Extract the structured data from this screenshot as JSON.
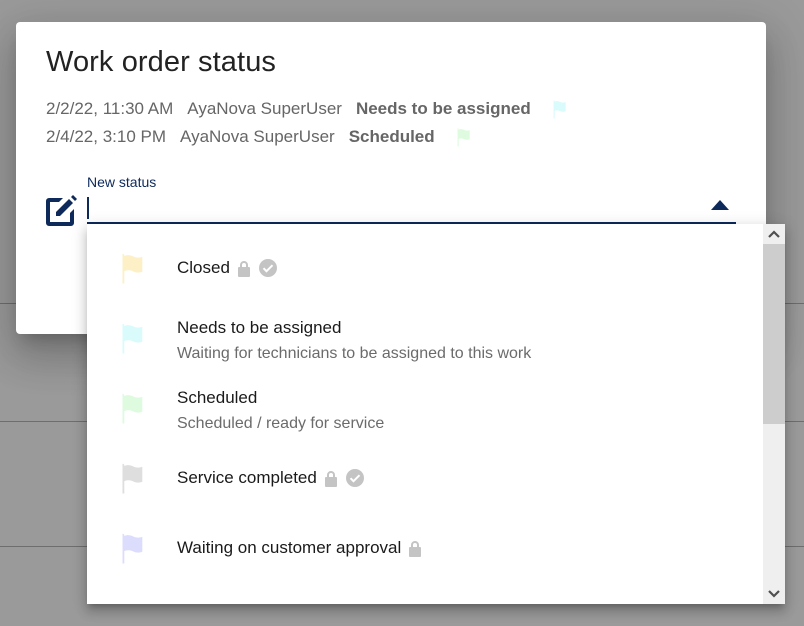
{
  "dialog": {
    "title": "Work order status",
    "history": [
      {
        "date": "2/2/22, 11:30 AM",
        "user": "AyaNova SuperUser",
        "status": "Needs to be assigned",
        "flag_color": "#d9fbfb",
        "flag_icon": "flag-icon"
      },
      {
        "date": "2/4/22, 3:10 PM",
        "user": "AyaNova SuperUser",
        "status": "Scheduled",
        "flag_color": "#defbdf",
        "flag_icon": "flag-icon"
      }
    ],
    "new_status": {
      "label": "New status",
      "value": "",
      "icon": "edit-icon",
      "accent_color": "#0d2a5b"
    }
  },
  "menu": {
    "items": [
      {
        "name": "Closed",
        "description": "",
        "flag_color": "#fdf0c6",
        "locked": true,
        "completed": true
      },
      {
        "name": "Needs to be assigned",
        "description": "Waiting for technicians to be assigned to this work",
        "flag_color": "#d9fbfb",
        "locked": false,
        "completed": false
      },
      {
        "name": "Scheduled",
        "description": "Scheduled / ready for service",
        "flag_color": "#defbdf",
        "locked": false,
        "completed": false
      },
      {
        "name": "Service completed",
        "description": "",
        "flag_color": "#dedede",
        "locked": true,
        "completed": true
      },
      {
        "name": "Waiting on customer approval",
        "description": "",
        "flag_color": "#dcdcfd",
        "locked": true,
        "completed": false
      }
    ],
    "icon_color": "#c4c4c4",
    "scroll_position_fraction": 0
  }
}
